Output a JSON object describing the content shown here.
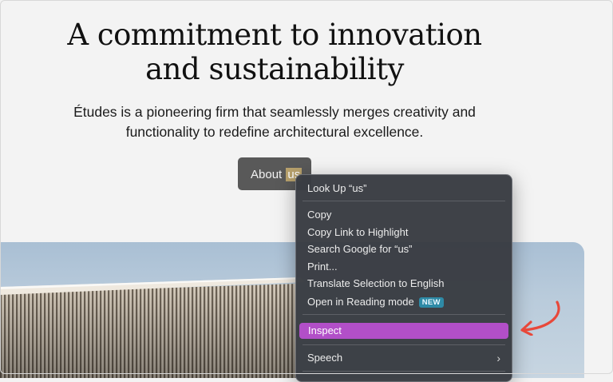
{
  "hero": {
    "title": "A commitment to innovation and sustainability",
    "description": "Études is a pioneering firm that seamlessly merges creativity and functionality to redefine architectural excellence.",
    "button_prefix": "About ",
    "button_selected": "us"
  },
  "context_menu": {
    "items": [
      {
        "label": "Look Up “us”"
      },
      {
        "label": "Copy"
      },
      {
        "label": "Copy Link to Highlight"
      },
      {
        "label": "Search Google for “us”"
      },
      {
        "label": "Print..."
      },
      {
        "label": "Translate Selection to English"
      },
      {
        "label": "Open in Reading mode",
        "badge": "NEW"
      },
      {
        "label": "Inspect",
        "highlighted": true
      },
      {
        "label": "Speech",
        "submenu": true
      }
    ]
  },
  "colors": {
    "menu_bg": "#393c42",
    "highlight": "#b24fc8",
    "annotation_arrow": "#e8483a",
    "badge": "#2e8aa6"
  },
  "icons": {
    "submenu": "chevron-right-icon",
    "annotation": "curved-arrow-icon"
  }
}
